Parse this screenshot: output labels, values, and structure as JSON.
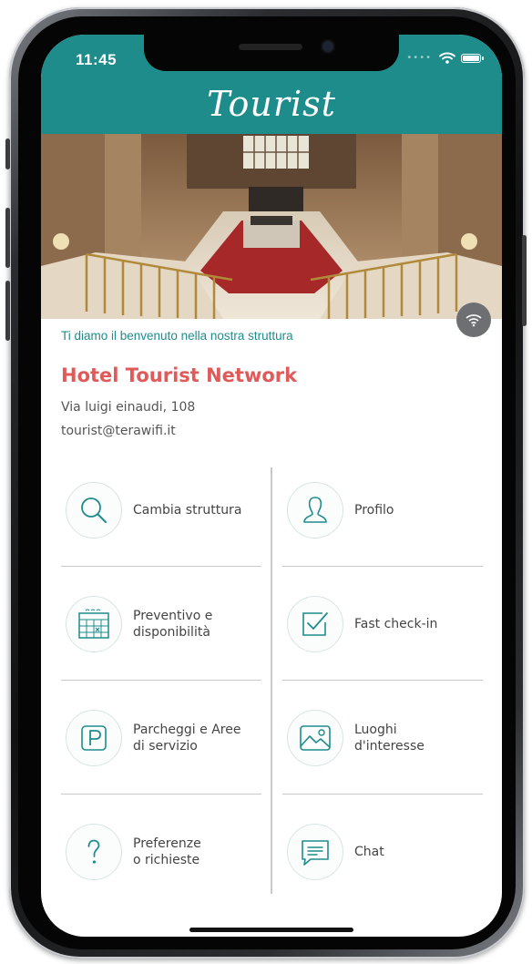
{
  "status_bar": {
    "time": "11:45"
  },
  "header": {
    "brand": "Tourist",
    "color": "#1f8c8c"
  },
  "hero": {
    "image": "hotel-lobby-staircase-photo"
  },
  "hotel": {
    "welcome": "Ti diamo il benvenuto nella nostra struttura",
    "name": "Hotel Tourist Network",
    "address": "Via luigi einaudi, 108",
    "email": "tourist@terawifi.it"
  },
  "menu": [
    {
      "line1": "Cambia struttura",
      "line2": "",
      "icon": "search-icon"
    },
    {
      "line1": "Profilo",
      "line2": "",
      "icon": "user-icon"
    },
    {
      "line1": "Preventivo e",
      "line2": "disponibilità",
      "icon": "calendar-icon"
    },
    {
      "line1": "Fast check-in",
      "line2": "",
      "icon": "checkbox-icon"
    },
    {
      "line1": "Parcheggi e Aree",
      "line2": "di servizio",
      "icon": "parking-icon"
    },
    {
      "line1": "Luoghi",
      "line2": "d'interesse",
      "icon": "picture-icon"
    },
    {
      "line1": "Preferenze",
      "line2": "o richieste",
      "icon": "question-icon"
    },
    {
      "line1": "Chat",
      "line2": "",
      "icon": "chat-icon"
    }
  ],
  "colors": {
    "accent": "#1f8c8c",
    "title": "#e05a5a",
    "text": "#555555"
  }
}
